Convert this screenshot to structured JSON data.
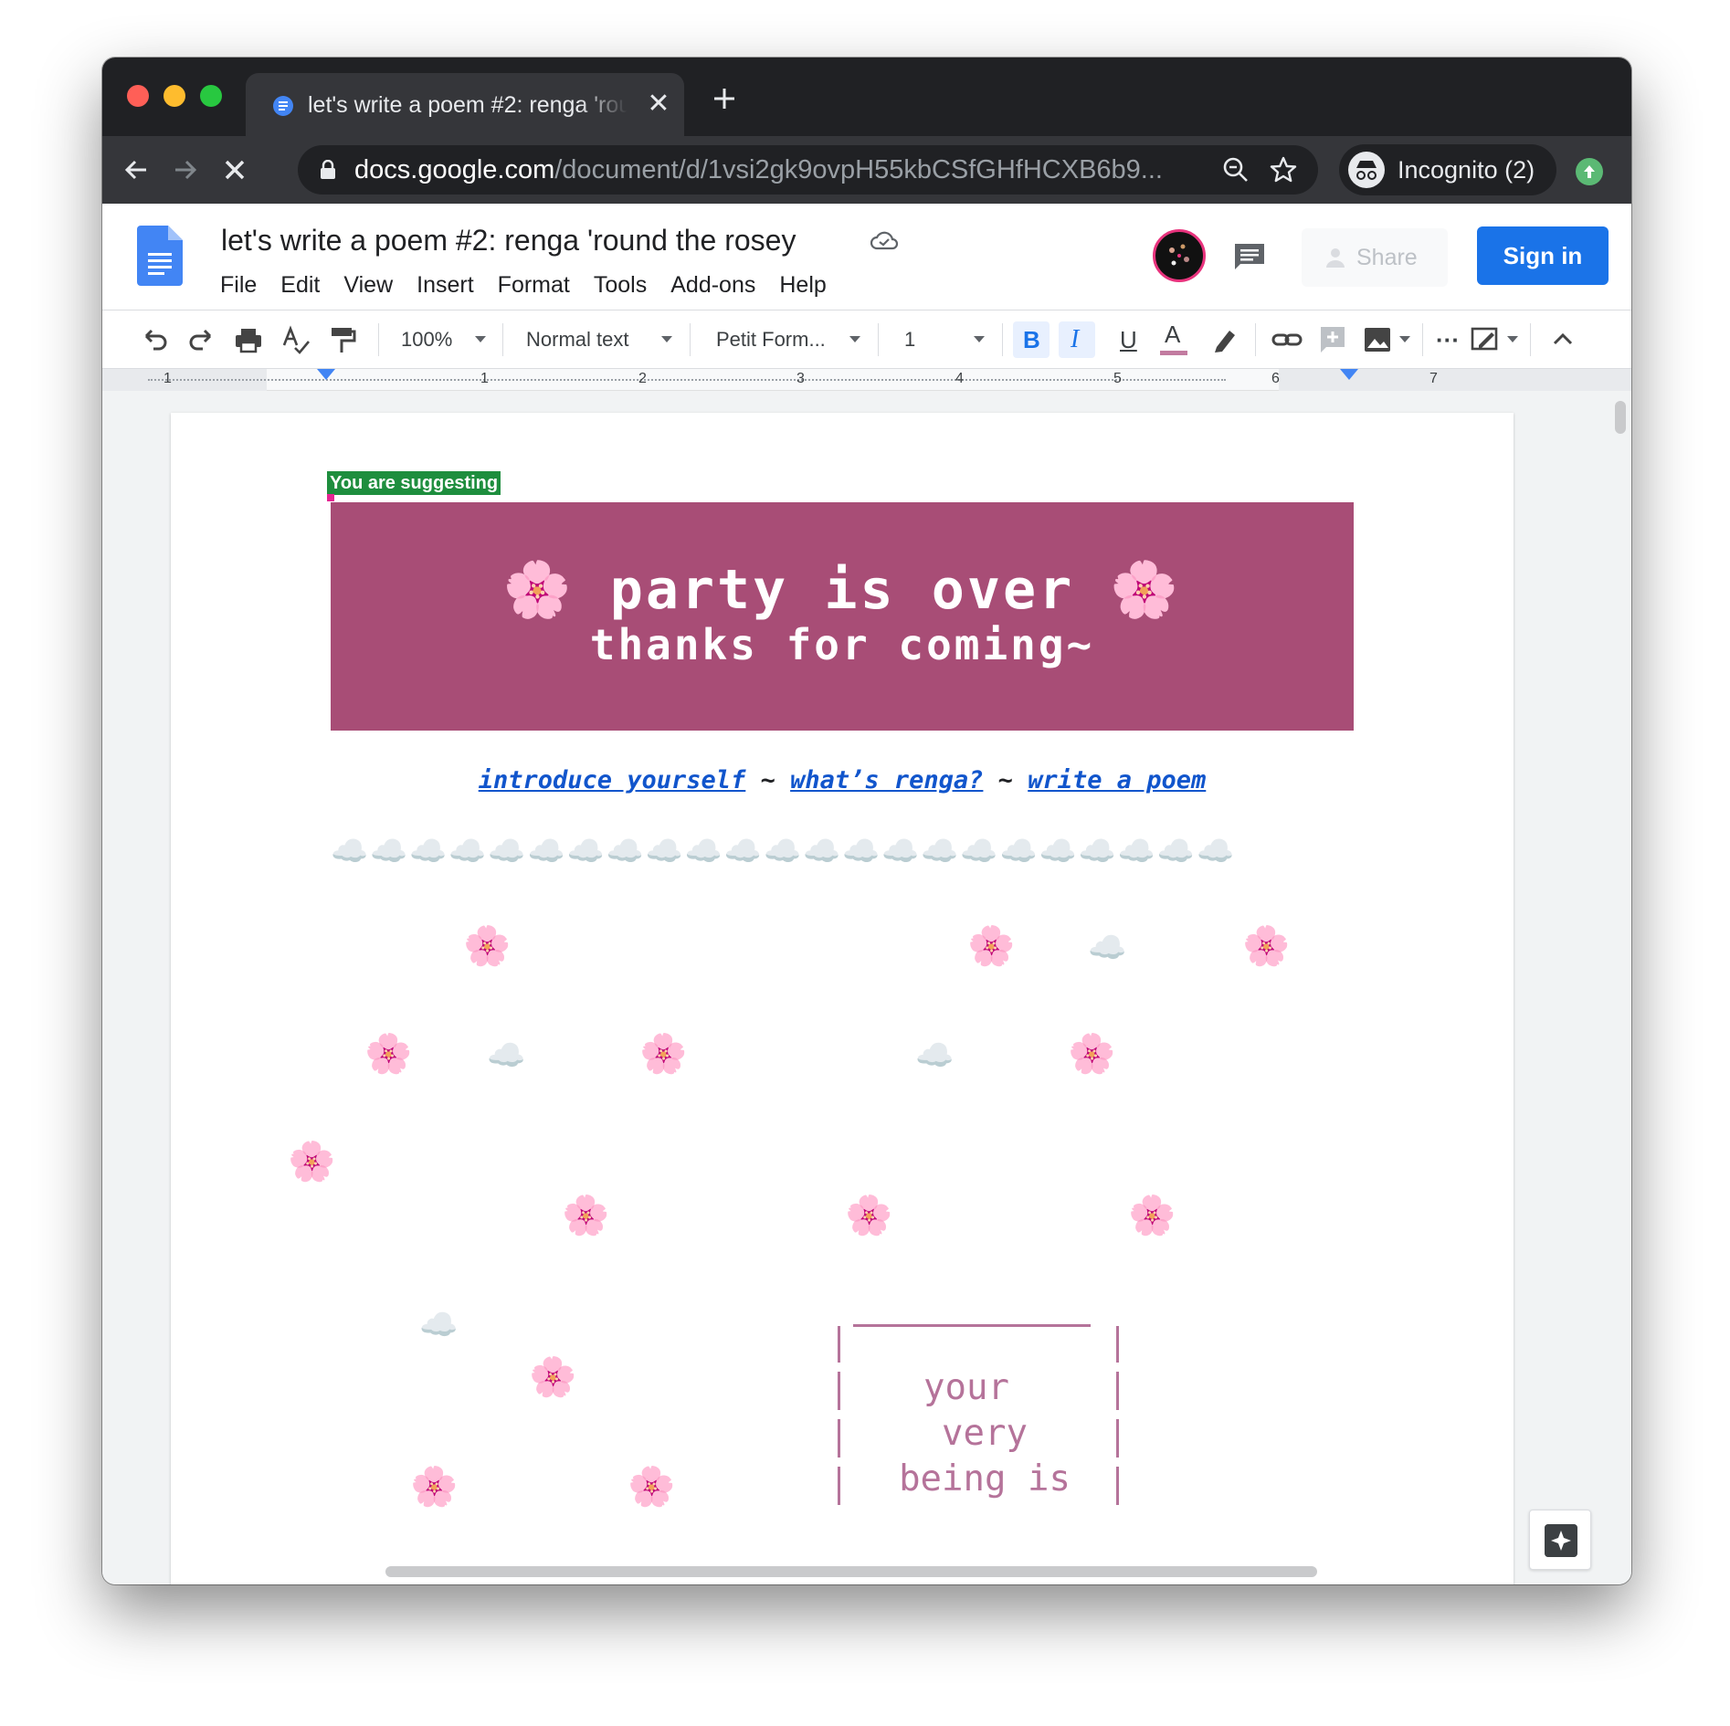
{
  "browser": {
    "tab_title": "let's write a poem #2: renga 'round the rosey",
    "tab_close": "✕",
    "new_tab": "+",
    "url_host": "docs.google.com",
    "url_path": "/document/d/1vsi2gk9ovpH55kbCSfGHfHCXB6b9...",
    "incognito_label": "Incognito (2)"
  },
  "docs": {
    "title": "let's write a poem #2: renga 'round the rosey",
    "menu": [
      "File",
      "Edit",
      "View",
      "Insert",
      "Format",
      "Tools",
      "Add-ons",
      "Help"
    ],
    "share_label": "Share",
    "signin_label": "Sign in"
  },
  "toolbar": {
    "zoom": "100%",
    "style": "Normal text",
    "font": "Petit Form...",
    "font_size": "1",
    "bold": "B",
    "italic": "I",
    "underline": "U",
    "text_color_letter": "A",
    "text_color": "#c27ba0"
  },
  "ruler": {
    "numbers": [
      "1",
      "1",
      "2",
      "3",
      "4",
      "5",
      "6",
      "7"
    ]
  },
  "document": {
    "suggest_badge": "You are suggesting",
    "banner_color": "#a84d76",
    "banner_line1": "🌸 party is over 🌸",
    "banner_line2": "thanks for coming~",
    "links": {
      "introduce": "introduce yourself",
      "sep1": " ~ ",
      "renga": "what’s renga?",
      "sep2": " ~ ",
      "write": "write a poem"
    },
    "cloud_row": "☁️☁️☁️☁️☁️☁️☁️☁️☁️☁️☁️☁️☁️☁️☁️☁️☁️☁️☁️☁️☁️☁️☁️",
    "flower": "🌸",
    "cloud": "☁️",
    "poem_lines": [
      "your",
      "very",
      "being is"
    ],
    "poem_color": "#b5739a"
  }
}
